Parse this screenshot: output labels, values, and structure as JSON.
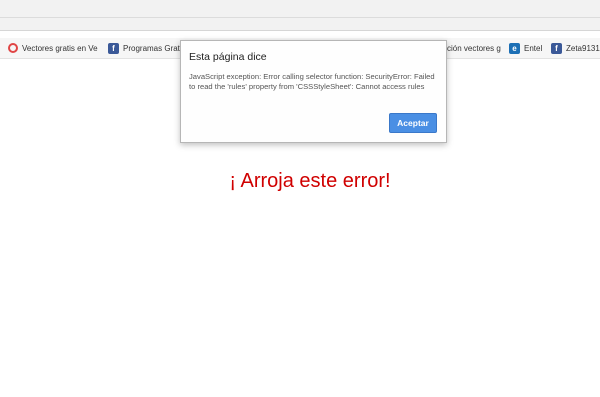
{
  "bookmarks": [
    {
      "label": "Vectores gratis en Ve",
      "icon": "opera-icon"
    },
    {
      "label": "Programas Grat",
      "icon": "facebook-icon"
    },
    {
      "label": "ción vectores g",
      "icon": ""
    },
    {
      "label": "Entel",
      "icon": "edge-icon"
    },
    {
      "label": "Zeta9131",
      "icon": "facebook-icon"
    }
  ],
  "dialog": {
    "title": "Esta página dice",
    "message": "JavaScript exception: Error calling selector function: SecurityError: Failed to read the 'rules' property from 'CSSStyleSheet': Cannot access rules",
    "button_label": "Aceptar"
  },
  "page": {
    "error_text": "¡ Arroja este error!"
  },
  "colors": {
    "error_text": "#d00000",
    "button": "#4a8fe4"
  }
}
